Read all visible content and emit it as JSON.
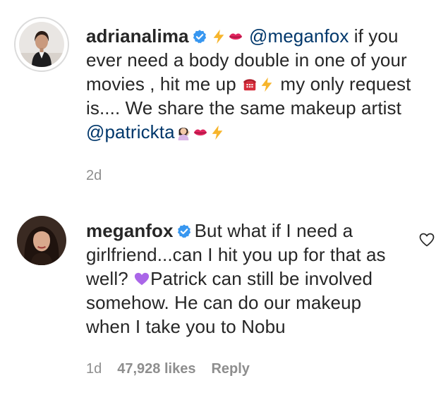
{
  "comments": [
    {
      "username": "adrianalima",
      "verified": true,
      "text_parts": {
        "mention1": "@meganfox",
        "part1": " if you ever need a body double in one of your movies , hit me up ",
        "part2": " my only request is.... We share the same makeup artist ",
        "mention2": "@patrickta"
      },
      "emojis": [
        "lightning-emoji",
        "kiss-lips-emoji",
        "telephone-emoji",
        "lightning-emoji",
        "woman-tipping-hand-emoji",
        "kiss-lips-emoji",
        "lightning-emoji"
      ],
      "meta": {
        "time": "2d"
      }
    },
    {
      "username": "meganfox",
      "verified": true,
      "text_parts": {
        "part1": "But what if I need a girlfriend...can I hit you up for that as well? ",
        "part2": "Patrick can still be involved somehow. He can do our makeup when I take you to Nobu"
      },
      "emojis": [
        "purple-heart-emoji"
      ],
      "meta": {
        "time": "1d",
        "likes": "47,928 likes",
        "reply": "Reply"
      }
    }
  ],
  "colors": {
    "text": "#262626",
    "mention": "#00376b",
    "meta": "#8e8e8e",
    "verified": "#3897f0",
    "lightning": "#f7b52c",
    "lips": "#e0245e",
    "purple_heart": "#aa66e8"
  }
}
